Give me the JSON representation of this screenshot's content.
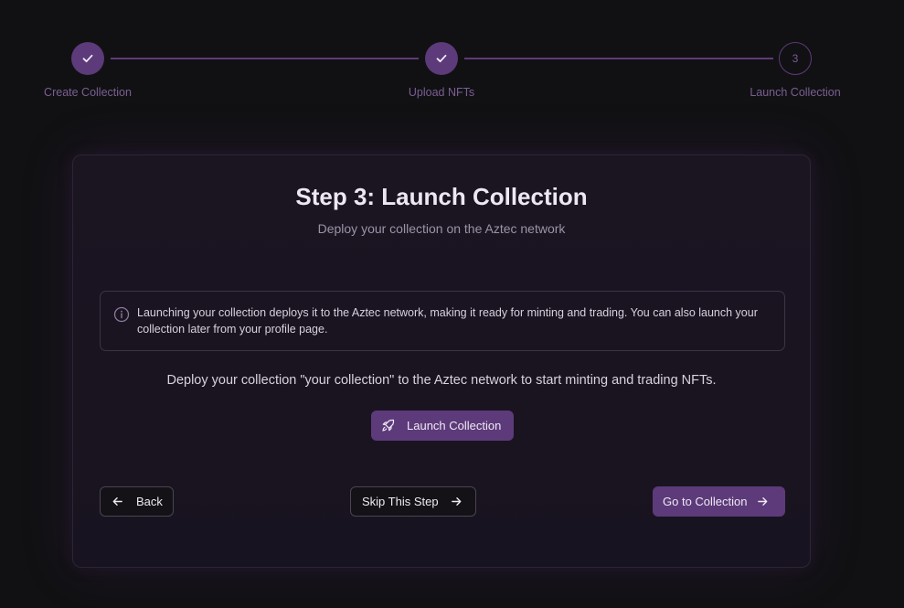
{
  "stepper": {
    "steps": [
      {
        "label": "Create Collection",
        "state": "done",
        "icon": "check-icon"
      },
      {
        "label": "Upload NFTs",
        "state": "done",
        "icon": "check-icon"
      },
      {
        "label": "Launch Collection",
        "state": "current",
        "number": "3"
      }
    ]
  },
  "card": {
    "title": "Step 3: Launch Collection",
    "subtitle": "Deploy your collection on the Aztec network",
    "info": {
      "icon": "info-icon",
      "text": "Launching your collection deploys it to the Aztec network, making it ready for minting and trading. You can also launch your collection later from your profile page."
    },
    "deploy_text": "Deploy your collection \"your collection\" to the Aztec network to start minting and trading NFTs.",
    "launch_button": {
      "label": "Launch Collection",
      "icon": "rocket-icon"
    },
    "back_button": {
      "label": "Back",
      "icon": "arrow-left-icon"
    },
    "skip_button": {
      "label": "Skip This Step",
      "icon": "arrow-right-icon"
    },
    "goto_button": {
      "label": "Go to Collection",
      "icon": "arrow-right-icon"
    }
  },
  "colors": {
    "background": "#111113",
    "accent": "#5d3a7a",
    "step_label": "#7a5f93"
  }
}
